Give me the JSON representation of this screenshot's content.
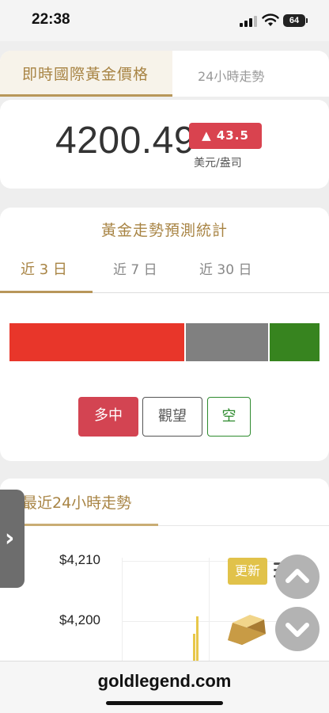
{
  "status": {
    "time": "22:38",
    "battery": "64"
  },
  "price_card": {
    "tabs": [
      {
        "label": "即時國際黃金價格"
      },
      {
        "label": "24小時走勢"
      }
    ],
    "price": "4200.49",
    "change": "▲ 43.5",
    "unit": "美元/盎司",
    "change_color": "#d9434f"
  },
  "forecast": {
    "title": "黃金走勢預測統計",
    "tabs": [
      {
        "label": "近 3 日"
      },
      {
        "label": "近 7 日"
      },
      {
        "label": "近 30 日"
      }
    ],
    "distribution": [
      {
        "key": "long",
        "fraction": 0.57,
        "color": "#e8362a"
      },
      {
        "key": "watch",
        "fraction": 0.27,
        "color": "#808080"
      },
      {
        "key": "short",
        "fraction": 0.16,
        "color": "#37841f"
      }
    ],
    "buttons": {
      "long": "多中",
      "watch": "觀望",
      "short": "空"
    }
  },
  "trend": {
    "title": "最近24小時走勢",
    "y_ticks": [
      "$4,210",
      "$4,200"
    ],
    "update_label": "更新"
  },
  "footer": {
    "domain": "goldlegend.com"
  }
}
